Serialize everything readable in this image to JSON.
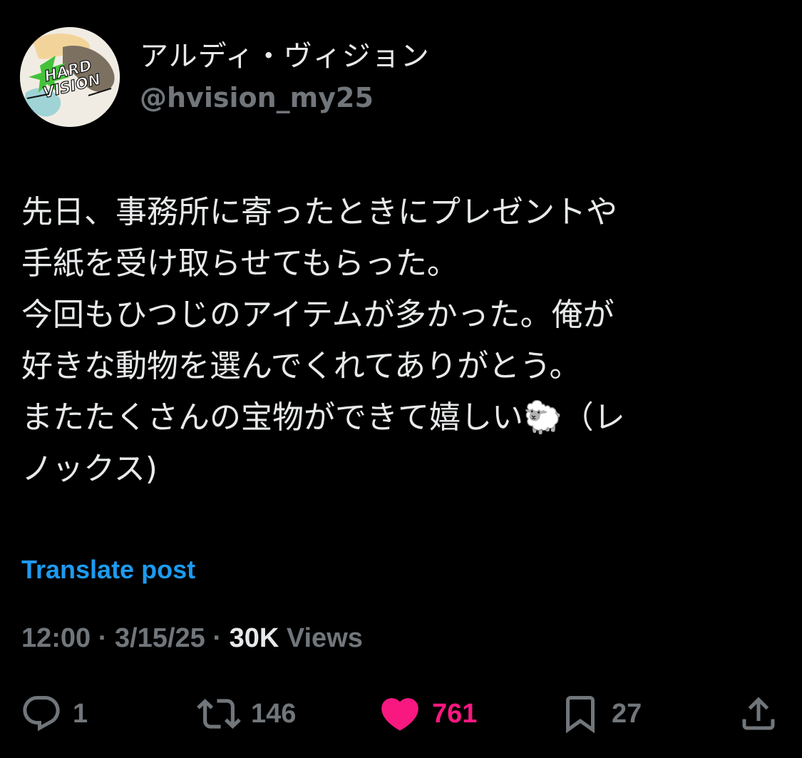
{
  "user": {
    "display_name": "アルディ・ヴィジョン",
    "handle": "@hvision_my25",
    "avatar_logo_text": "HARD VISION"
  },
  "post": {
    "lines": [
      "先日、事務所に寄ったときにプレゼントや",
      "手紙を受け取らせてもらった。",
      "今回もひつじのアイテムが多かった。俺が",
      "好きな動物を選んでくれてありがとう。",
      "またたくさんの宝物ができて嬉しい🐑（レ",
      "ノックス)"
    ]
  },
  "translate_label": "Translate post",
  "meta": {
    "time": "12:00",
    "date": "3/15/25",
    "views_count": "30K",
    "views_label": "Views",
    "separator": "·"
  },
  "actions": {
    "reply": {
      "icon": "reply-icon",
      "count": "1"
    },
    "repost": {
      "icon": "repost-icon",
      "count": "146"
    },
    "like": {
      "icon": "heart-icon",
      "count": "761",
      "active": true
    },
    "bookmark": {
      "icon": "bookmark-icon",
      "count": "27"
    },
    "share": {
      "icon": "share-icon"
    }
  },
  "colors": {
    "background": "#000000",
    "text_primary": "#e7e9ea",
    "text_secondary": "#71767b",
    "link": "#1d9bf0",
    "like_active": "#f91880"
  }
}
